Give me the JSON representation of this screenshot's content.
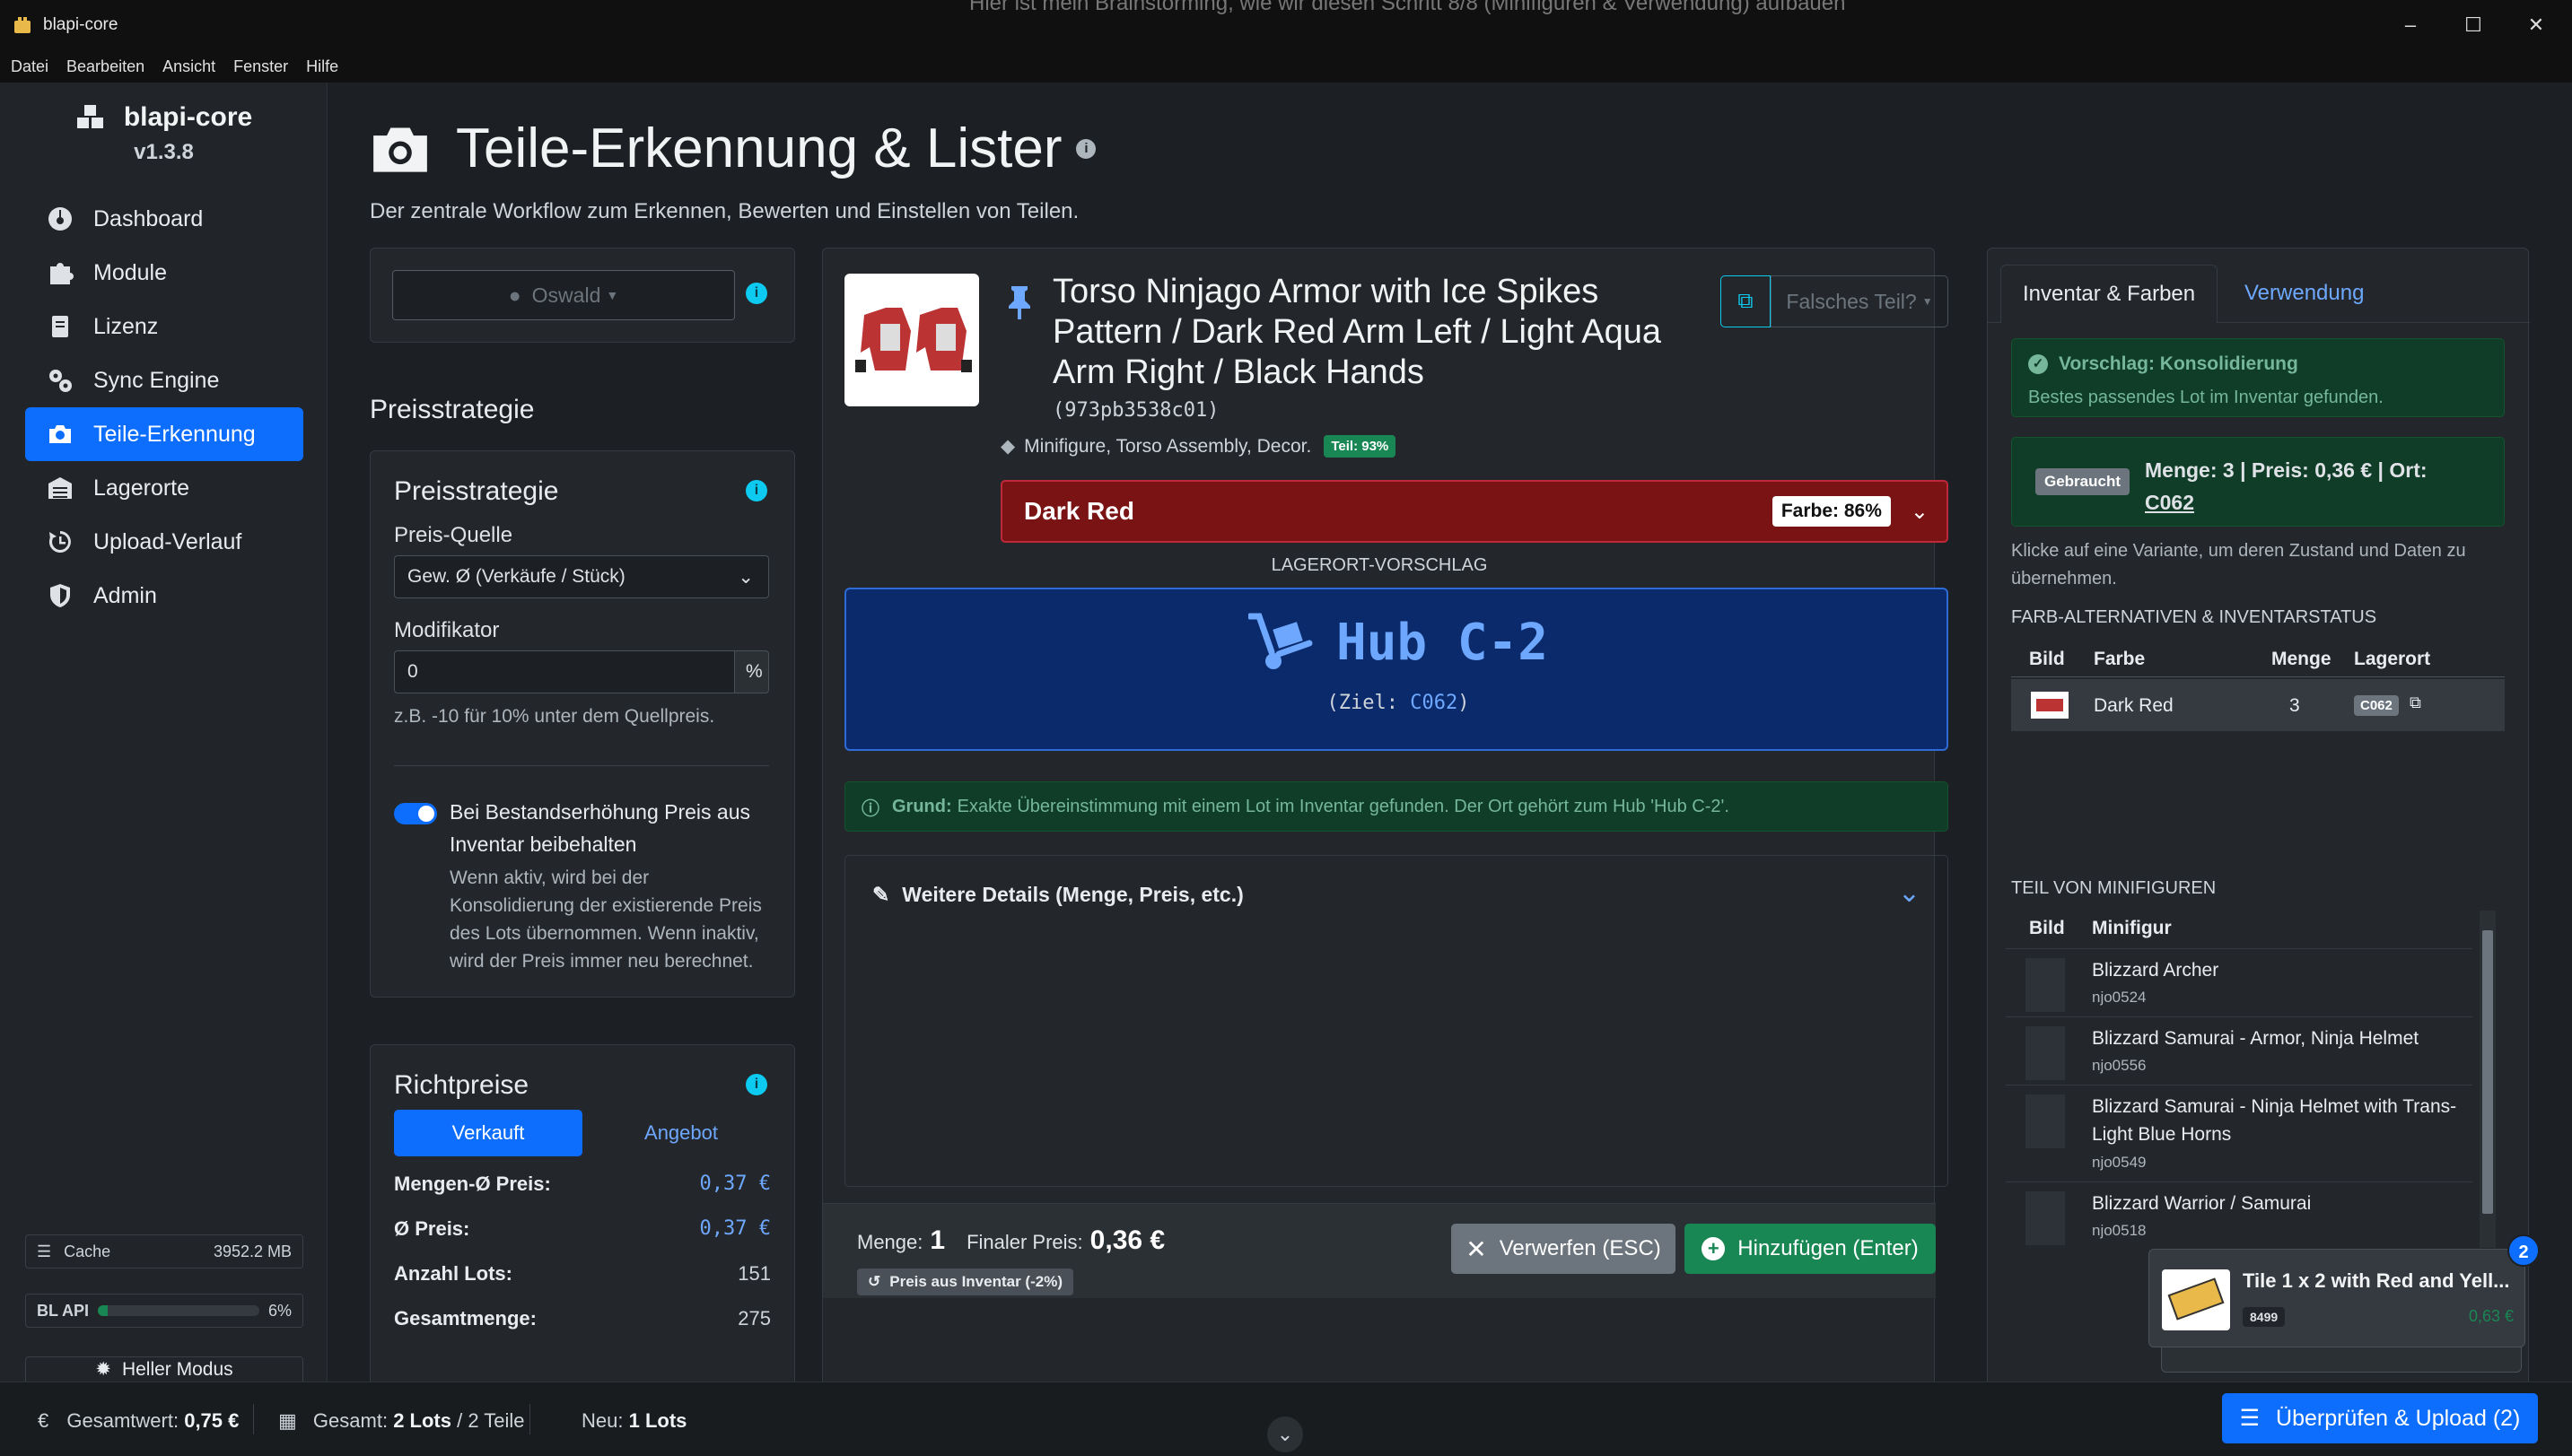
{
  "window": {
    "title": "blapi-core",
    "ghost_text": "Hier ist mein Brainstorming, wie wir diesen Schritt 8/8 (Minifiguren & Verwendung) aufbauen"
  },
  "menu": [
    "Datei",
    "Bearbeiten",
    "Ansicht",
    "Fenster",
    "Hilfe"
  ],
  "sidebar": {
    "brand": "blapi-core",
    "version": "v1.3.8",
    "items": [
      {
        "label": "Dashboard",
        "icon": "dashboard-icon"
      },
      {
        "label": "Module",
        "icon": "puzzle-icon"
      },
      {
        "label": "Lizenz",
        "icon": "license-icon"
      },
      {
        "label": "Sync Engine",
        "icon": "gears-icon"
      },
      {
        "label": "Teile-Erkennung",
        "icon": "camera-icon",
        "active": true
      },
      {
        "label": "Lagerorte",
        "icon": "warehouse-icon"
      },
      {
        "label": "Upload-Verlauf",
        "icon": "history-icon"
      },
      {
        "label": "Admin",
        "icon": "shield-icon"
      }
    ],
    "cache_label": "Cache",
    "cache_value": "3952.2 MB",
    "api_label": "BL API",
    "api_percent": "6%",
    "api_fraction": 0.06,
    "mode_button": "Heller Modus"
  },
  "page": {
    "title": "Teile-Erkennung & Lister",
    "subtitle": "Der zentrale Workflow zum Erkennen, Bewerten und Einstellen von Teilen."
  },
  "left": {
    "user_select": "Oswald",
    "strategy_heading": "Preisstrategie",
    "strategy_card_title": "Preisstrategie",
    "source_label": "Preis-Quelle",
    "source_value": "Gew. Ø (Verkäufe / Stück)",
    "modifier_label": "Modifikator",
    "modifier_value": "0",
    "modifier_unit": "%",
    "modifier_hint": "z.B. -10 für 10% unter dem Quellpreis.",
    "keep_price_label": "Bei Bestandserhöhung Preis aus Inventar beibehalten",
    "keep_price_help": "Wenn aktiv, wird bei der Konsolidierung der existierende Preis des Lots übernommen. Wenn inaktiv, wird der Preis immer neu berechnet.",
    "richt_title": "Richtpreise",
    "tab_sold": "Verkauft",
    "tab_offer": "Angebot",
    "rows": [
      {
        "k": "Mengen-Ø Preis:",
        "v": "0,37 €",
        "blue": true
      },
      {
        "k": "Ø Preis:",
        "v": "0,37 €",
        "blue": true
      },
      {
        "k": "Anzahl Lots:",
        "v": "151"
      },
      {
        "k": "Gesamtmenge:",
        "v": "275"
      }
    ]
  },
  "part": {
    "name": "Torso Ninjago Armor with Ice Spikes Pattern / Dark Red Arm Left / Light Aqua Arm Right / Black Hands",
    "id": "(973pb3538c01)",
    "wrong_part": "Falsches Teil?",
    "tags": "Minifigure, Torso Assembly, Decor.",
    "part_conf": "Teil: 93%",
    "color": "Dark Red",
    "color_conf": "Farbe: 86%",
    "color_hex": "#7a1414",
    "location_heading": "LAGERORT-VORSCHLAG",
    "location_name": "Hub C-2",
    "location_target_label": "(Ziel: ",
    "location_target": "C062",
    "location_target_end": ")",
    "reason_label": "Grund:",
    "reason_text": "Exakte Übereinstimmung mit einem Lot im Inventar gefunden. Der Ort gehört zum Hub 'Hub C-2'.",
    "details_label": "Weitere Details (Menge, Preis, etc.)",
    "qty_label": "Menge:",
    "qty": "1",
    "final_label": "Finaler Preis:",
    "final_price": "0,36 €",
    "price_badge": "Preis aus Inventar (-2%)",
    "discard": "Verwerfen (ESC)",
    "add": "Hinzufügen (Enter)"
  },
  "right": {
    "tab_inventory": "Inventar & Farben",
    "tab_usage": "Verwendung",
    "suggest_title": "Vorschlag: Konsolidierung",
    "suggest_text": "Bestes passendes Lot im Inventar gefunden.",
    "lot_badge": "Gebraucht",
    "lot_info": "Menge: 3 | Preis: 0,36 € | Ort:",
    "lot_loc": "C062",
    "variant_hint": "Klicke auf eine Variante, um deren Zustand und Daten zu übernehmen.",
    "color_section": "FARB-ALTERNATIVEN & INVENTARSTATUS",
    "color_cols": [
      "Bild",
      "Farbe",
      "Menge",
      "Lagerort"
    ],
    "color_row": {
      "farbe": "Dark Red",
      "menge": "3",
      "ort": "C062"
    },
    "minifig_section": "TEIL VON MINIFIGUREN",
    "minifig_cols": [
      "Bild",
      "Minifigur"
    ],
    "minifigs": [
      {
        "name": "Blizzard Archer",
        "id": "njo0524"
      },
      {
        "name": "Blizzard Samurai - Armor, Ninja Helmet",
        "id": "njo0556"
      },
      {
        "name": "Blizzard Samurai - Ninja Helmet with Trans-Light Blue Horns",
        "id": "njo0549"
      },
      {
        "name": "Blizzard Warrior / Samurai",
        "id": "njo0518"
      }
    ],
    "queue_count": "2",
    "queue_title": "Tile 1 x 2 with Red and Yell...",
    "queue_id": "8499",
    "queue_price": "0,63 €"
  },
  "status": {
    "total_label": "Gesamtwert:",
    "total": "0,75 €",
    "sum_label": "Gesamt:",
    "lots": "2 Lots",
    "sep": " / ",
    "parts": "2 Teile",
    "new_label": "Neu:",
    "new": "1 Lots",
    "upload": "Überprüfen & Upload (2)"
  }
}
